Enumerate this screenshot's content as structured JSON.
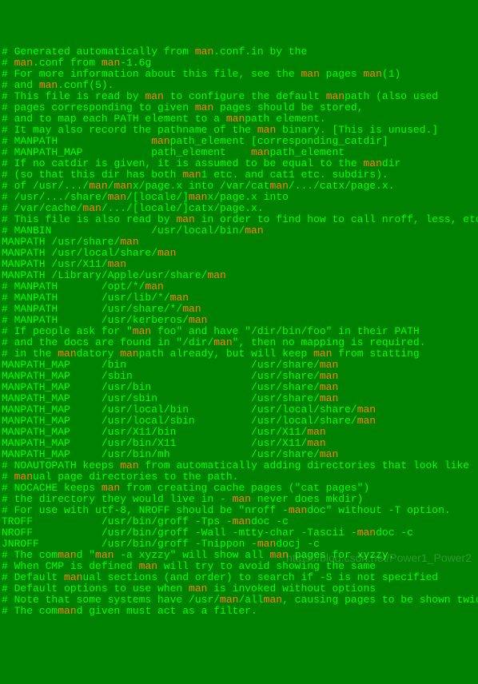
{
  "hl": "man",
  "lines": [
    [
      [
        "t",
        "# Generated automatically from "
      ],
      [
        "h",
        "man"
      ],
      [
        "t",
        ".conf.in by the"
      ]
    ],
    [
      [
        "t",
        "# "
      ],
      [
        "h",
        "man"
      ],
      [
        "t",
        ".conf from "
      ],
      [
        "h",
        "man"
      ],
      [
        "t",
        "-1.6g"
      ]
    ],
    [
      [
        "t",
        "# For more information about this file, see the "
      ],
      [
        "h",
        "man"
      ],
      [
        "t",
        " pages "
      ],
      [
        "h",
        "man"
      ],
      [
        "t",
        "(1)"
      ]
    ],
    [
      [
        "t",
        "# and "
      ],
      [
        "h",
        "man"
      ],
      [
        "t",
        ".conf(5)."
      ]
    ],
    [
      [
        "t",
        "# This file is read by "
      ],
      [
        "h",
        "man"
      ],
      [
        "t",
        " to configure the default "
      ],
      [
        "h",
        "man"
      ],
      [
        "t",
        "path (also used"
      ]
    ],
    [
      [
        "t",
        "# pages corresponding to given "
      ],
      [
        "h",
        "man"
      ],
      [
        "t",
        " pages should be stored,"
      ]
    ],
    [
      [
        "t",
        "# and to map each PATH element to a "
      ],
      [
        "h",
        "man"
      ],
      [
        "t",
        "path element."
      ]
    ],
    [
      [
        "t",
        "# It may also record the pathname of the "
      ],
      [
        "h",
        "man"
      ],
      [
        "t",
        " binary. [This is unused.]"
      ]
    ],
    [
      [
        "t",
        "# MANPATH               "
      ],
      [
        "h",
        "man"
      ],
      [
        "t",
        "path_element [corresponding_catdir]"
      ]
    ],
    [
      [
        "t",
        "# MANPATH_MAP           path_element    "
      ],
      [
        "h",
        "man"
      ],
      [
        "t",
        "path_element"
      ]
    ],
    [
      [
        "t",
        "# If no catdir is given, it is assumed to be equal to the "
      ],
      [
        "h",
        "man"
      ],
      [
        "t",
        "dir"
      ]
    ],
    [
      [
        "t",
        "# (so that this dir has both "
      ],
      [
        "h",
        "man"
      ],
      [
        "t",
        "1 etc. and cat1 etc. subdirs)."
      ]
    ],
    [
      [
        "t",
        "# of /usr/.../"
      ],
      [
        "h",
        "man"
      ],
      [
        "t",
        "/"
      ],
      [
        "h",
        "man"
      ],
      [
        "t",
        "x/page.x into /var/cat"
      ],
      [
        "h",
        "man"
      ],
      [
        "t",
        "/.../catx/page.x."
      ]
    ],
    [
      [
        "t",
        "# /usr/.../share/"
      ],
      [
        "h",
        "man"
      ],
      [
        "t",
        "/[locale/]"
      ],
      [
        "h",
        "man"
      ],
      [
        "t",
        "x/page.x into"
      ]
    ],
    [
      [
        "t",
        "# /var/cache/"
      ],
      [
        "h",
        "man"
      ],
      [
        "t",
        "/.../[locale/]catx/page.x."
      ]
    ],
    [
      [
        "t",
        "# This file is also read by "
      ],
      [
        "h",
        "man"
      ],
      [
        "t",
        " in order to find how to call nroff, less, etc.,"
      ]
    ],
    [
      [
        "t",
        "# MANBIN                /usr/local/bin/"
      ],
      [
        "h",
        "man"
      ]
    ],
    [
      [
        "t",
        "MANPATH /usr/share/"
      ],
      [
        "h",
        "man"
      ]
    ],
    [
      [
        "t",
        "MANPATH /usr/local/share/"
      ],
      [
        "h",
        "man"
      ]
    ],
    [
      [
        "t",
        "MANPATH /usr/X11/"
      ],
      [
        "h",
        "man"
      ]
    ],
    [
      [
        "t",
        "MANPATH /Library/Apple/usr/share/"
      ],
      [
        "h",
        "man"
      ]
    ],
    [
      [
        "t",
        "# MANPATH       /opt/*/"
      ],
      [
        "h",
        "man"
      ]
    ],
    [
      [
        "t",
        "# MANPATH       /usr/lib/*/"
      ],
      [
        "h",
        "man"
      ]
    ],
    [
      [
        "t",
        "# MANPATH       /usr/share/*/"
      ],
      [
        "h",
        "man"
      ]
    ],
    [
      [
        "t",
        "# MANPATH       /usr/kerberos/"
      ],
      [
        "h",
        "man"
      ]
    ],
    [
      [
        "t",
        "# If people ask for \""
      ],
      [
        "h",
        "man"
      ],
      [
        "t",
        " foo\" and have \"/dir/bin/foo\" in their PATH"
      ]
    ],
    [
      [
        "t",
        "# and the docs are found in \"/dir/"
      ],
      [
        "h",
        "man"
      ],
      [
        "t",
        "\", then no mapping is required."
      ]
    ],
    [
      [
        "t",
        "# in the "
      ],
      [
        "h",
        "man"
      ],
      [
        "t",
        "datory "
      ],
      [
        "h",
        "man"
      ],
      [
        "t",
        "path already, but will keep "
      ],
      [
        "h",
        "man"
      ],
      [
        "t",
        " from statting"
      ]
    ],
    [
      [
        "t",
        "MANPATH_MAP     /bin                    /usr/share/"
      ],
      [
        "h",
        "man"
      ]
    ],
    [
      [
        "t",
        "MANPATH_MAP     /sbin                   /usr/share/"
      ],
      [
        "h",
        "man"
      ]
    ],
    [
      [
        "t",
        "MANPATH_MAP     /usr/bin                /usr/share/"
      ],
      [
        "h",
        "man"
      ]
    ],
    [
      [
        "t",
        "MANPATH_MAP     /usr/sbin               /usr/share/"
      ],
      [
        "h",
        "man"
      ]
    ],
    [
      [
        "t",
        "MANPATH_MAP     /usr/local/bin          /usr/local/share/"
      ],
      [
        "h",
        "man"
      ]
    ],
    [
      [
        "t",
        "MANPATH_MAP     /usr/local/sbin         /usr/local/share/"
      ],
      [
        "h",
        "man"
      ]
    ],
    [
      [
        "t",
        "MANPATH_MAP     /usr/X11/bin            /usr/X11/"
      ],
      [
        "h",
        "man"
      ]
    ],
    [
      [
        "t",
        "MANPATH_MAP     /usr/bin/X11            /usr/X11/"
      ],
      [
        "h",
        "man"
      ]
    ],
    [
      [
        "t",
        "MANPATH_MAP     /usr/bin/mh             /usr/share/"
      ],
      [
        "h",
        "man"
      ]
    ],
    [
      [
        "t",
        "# NOAUTOPATH keeps "
      ],
      [
        "h",
        "man"
      ],
      [
        "t",
        " from automatically adding directories that look like"
      ]
    ],
    [
      [
        "t",
        "# "
      ],
      [
        "h",
        "man"
      ],
      [
        "t",
        "ual page directories to the path."
      ]
    ],
    [
      [
        "t",
        "# NOCACHE keeps "
      ],
      [
        "h",
        "man"
      ],
      [
        "t",
        " from creating cache pages (\"cat pages\")"
      ]
    ],
    [
      [
        "t",
        "# the directory they would live in - "
      ],
      [
        "h",
        "man"
      ],
      [
        "t",
        " never does mkdir)"
      ]
    ],
    [
      [
        "t",
        "# For use with utf-8, NROFF should be \"nroff -"
      ],
      [
        "h",
        "man"
      ],
      [
        "t",
        "doc\" without -T option."
      ]
    ],
    [
      [
        "t",
        "TROFF           /usr/bin/groff -Tps -"
      ],
      [
        "h",
        "man"
      ],
      [
        "t",
        "doc -c"
      ]
    ],
    [
      [
        "t",
        "NROFF           /usr/bin/groff -Wall -mtty-char -Tascii -"
      ],
      [
        "h",
        "man"
      ],
      [
        "t",
        "doc -c"
      ]
    ],
    [
      [
        "t",
        "JNROFF          /usr/bin/groff -Tnippon -"
      ],
      [
        "h",
        "man"
      ],
      [
        "t",
        "docj -c"
      ]
    ],
    [
      [
        "t",
        "# The com"
      ],
      [
        "h",
        "man"
      ],
      [
        "t",
        "d \""
      ],
      [
        "h",
        "man"
      ],
      [
        "t",
        " -a xyzzy\" will show all "
      ],
      [
        "h",
        "man"
      ],
      [
        "t",
        " pages for xyzzy."
      ]
    ],
    [
      [
        "t",
        "# When CMP is defined "
      ],
      [
        "h",
        "man"
      ],
      [
        "t",
        " will try to avoid showing the same"
      ]
    ],
    [
      [
        "t",
        "# Default "
      ],
      [
        "h",
        "man"
      ],
      [
        "t",
        "ual sections (and order) to search if -S is not specified"
      ]
    ],
    [
      [
        "t",
        "# Default options to use when "
      ],
      [
        "h",
        "man"
      ],
      [
        "t",
        " is invoked without options"
      ]
    ],
    [
      [
        "t",
        "# Note that some systems have /usr/"
      ],
      [
        "h",
        "man"
      ],
      [
        "t",
        "/all"
      ],
      [
        "h",
        "man"
      ],
      [
        "t",
        ", causing pages to be shown twice."
      ]
    ],
    [
      [
        "t",
        "# The com"
      ],
      [
        "h",
        "man"
      ],
      [
        "t",
        "d given must act as a filter."
      ]
    ]
  ],
  "watermark": "https://blog.csdn.net/Power1_Power2"
}
